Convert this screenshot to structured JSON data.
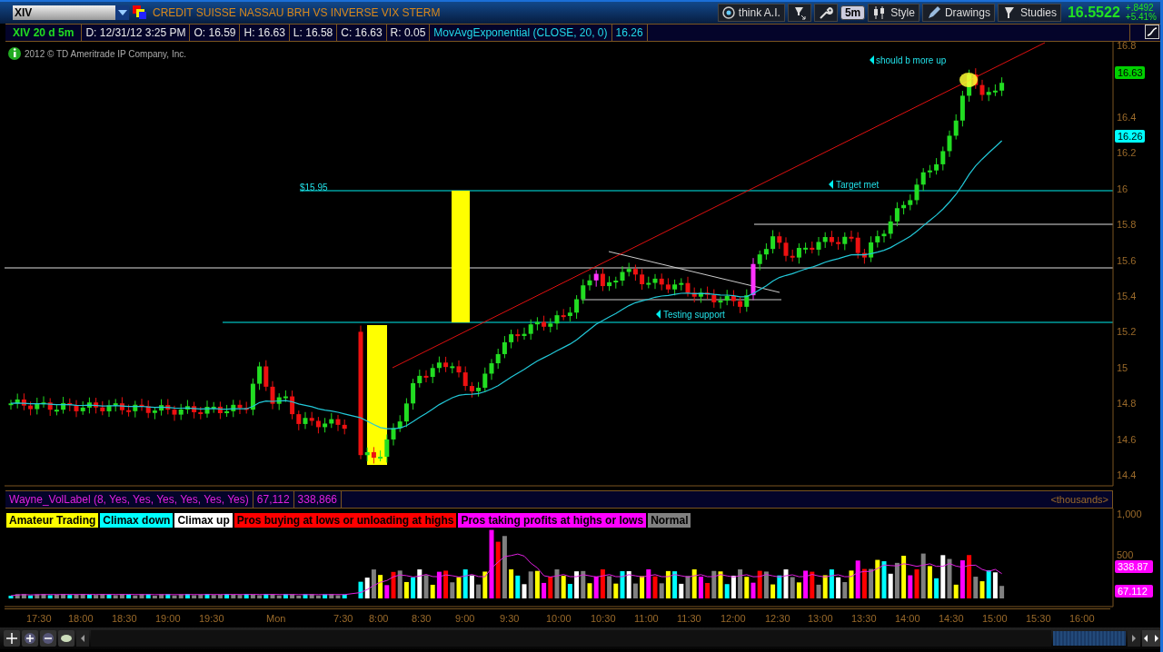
{
  "toolbar": {
    "symbol": "XIV",
    "title": "CREDIT SUISSE NASSAU BRH VS INVERSE VIX STERM",
    "buttons": [
      {
        "kind": "ai",
        "label": "think A.I."
      },
      {
        "kind": "flask-arrow"
      },
      {
        "kind": "wrench"
      },
      {
        "kind": "timeframe",
        "label": "5m"
      },
      {
        "kind": "style",
        "label": "Style"
      },
      {
        "kind": "drawings",
        "label": "Drawings"
      },
      {
        "kind": "studies",
        "label": "Studies"
      }
    ],
    "price": "16.5522",
    "change": "+.8492",
    "change_pct": "+5.41%"
  },
  "header": {
    "chart_label": "XIV 20 d 5m",
    "fields": [
      "D: 12/31/12 3:25 PM",
      "O: 16.59",
      "H: 16.63",
      "L: 16.58",
      "C: 16.63",
      "R: 0.05"
    ],
    "study": "MovAvgExponential (CLOSE, 20, 0)",
    "study_value": "16.26"
  },
  "copyright": "2012 © TD Ameritrade IP Company, Inc.",
  "price_chart": {
    "y_ticks": [
      "16.8",
      "16.4",
      "16.2",
      "16",
      "15.8",
      "15.6",
      "15.4",
      "15.2",
      "15",
      "14.8",
      "14.6",
      "14.4"
    ],
    "badges": [
      {
        "text": "16.63",
        "color": "#00d000"
      },
      {
        "text": "16.26",
        "color": "#00ffff"
      }
    ],
    "annotations": [
      {
        "kind": "label",
        "text": "$15.95"
      },
      {
        "kind": "arrow-label",
        "text": "Testing support"
      },
      {
        "kind": "arrow-label",
        "text": "Target met"
      },
      {
        "kind": "arrow-label",
        "text": "should b more up"
      }
    ]
  },
  "volume_panel": {
    "study": "Wayne_VolLabel (8, Yes, Yes, Yes, Yes, Yes, Yes)",
    "values": [
      "67,112",
      "338,866"
    ],
    "units": "<thousands>",
    "legend": [
      {
        "label": "Amateur Trading",
        "color": "#ffff00"
      },
      {
        "label": "Climax down",
        "color": "#00ffff"
      },
      {
        "label": "Climax up",
        "color": "#ffffff"
      },
      {
        "label": "Pros buying at lows or unloading at highs",
        "color": "#ff0000"
      },
      {
        "label": "Pros taking profits at highs or lows",
        "color": "#ff00ff"
      },
      {
        "label": "Normal",
        "color": "#808080"
      }
    ],
    "y_ticks": [
      "1,000",
      "500"
    ],
    "badges": [
      {
        "text": "338.87"
      },
      {
        "text": "67.112"
      }
    ]
  },
  "time_axis": [
    "17:30",
    "18:00",
    "18:30",
    "19:00",
    "19:30",
    "Mon",
    "7:30",
    "8:00",
    "8:30",
    "9:00",
    "9:30",
    "10:00",
    "10:30",
    "11:00",
    "11:30",
    "12:00",
    "12:30",
    "13:00",
    "13:30",
    "14:00",
    "14:30",
    "15:00",
    "15:30",
    "16:00"
  ]
}
